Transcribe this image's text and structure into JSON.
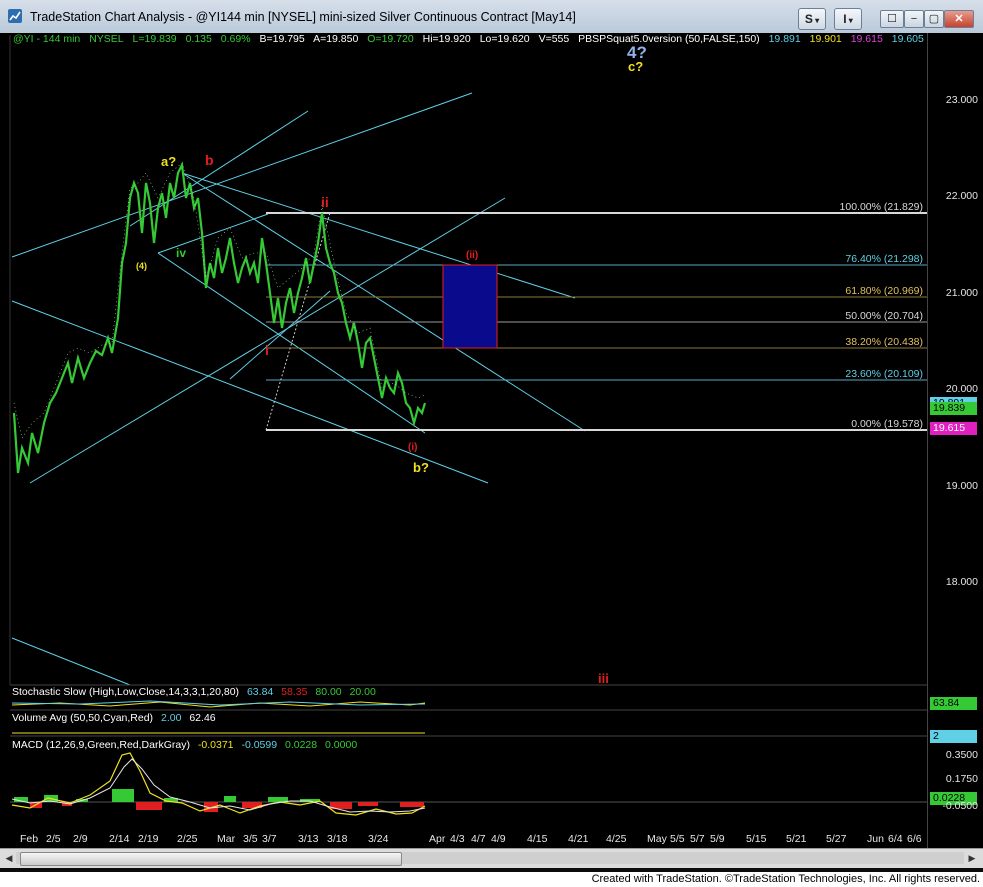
{
  "window": {
    "title": "TradeStation Chart Analysis - @YI144 min [NYSEL] mini-sized Silver Continuous Contract [May14]",
    "toolbar_s": "S",
    "toolbar_i": "I"
  },
  "status_line": {
    "symbol": "@YI - 144 min",
    "exchange": "NYSEL",
    "last": "L=19.839",
    "change": "0.135",
    "change_pct": "0.69%",
    "bid": "B=19.795",
    "ask": "A=19.850",
    "open": "O=19.720",
    "high": "Hi=19.920",
    "low": "Lo=19.620",
    "volume": "V=555",
    "study": "PBSPSquat5.0version (50,FALSE,150)",
    "study_values": [
      "19.891",
      "19.901",
      "19.615",
      "19.605"
    ]
  },
  "price_axis": {
    "labels": [
      "23.000",
      "22.000",
      "21.000",
      "20.000",
      "19.000",
      "18.000"
    ],
    "last_price_tag": "19.839",
    "partial_tag": "19.891",
    "low_tag": "19.615"
  },
  "fib_levels": [
    {
      "label": "100.00% (21.829)",
      "price": 21.829
    },
    {
      "label": "76.40% (21.298)",
      "price": 21.298
    },
    {
      "label": "61.80% (20.969)",
      "price": 20.969
    },
    {
      "label": "50.00% (20.704)",
      "price": 20.704
    },
    {
      "label": "38.20% (20.438)",
      "price": 20.438
    },
    {
      "label": "23.60% (20.109)",
      "price": 20.109
    },
    {
      "label": "0.00% (19.578)",
      "price": 19.578
    }
  ],
  "wave_labels": {
    "a_q": "a?",
    "b_red": "b",
    "ii_red": "ii",
    "i_red": "i",
    "iv": "iv",
    "four": "(4)",
    "i_circle": "(i)",
    "ii_circle": "(ii)",
    "b_q": "b?",
    "c_q": "c?",
    "four_q": "4?",
    "iii_red": "iii"
  },
  "indicators": {
    "stochastic": {
      "name": "Stochastic Slow (High,Low,Close,14,3,3,1,20,80)",
      "v1": "63.84",
      "v2": "58.35",
      "v3": "80.00",
      "v4": "20.00",
      "tag": "63.84"
    },
    "volume": {
      "name": "Volume Avg (50,50,Cyan,Red)",
      "v1": "2.00",
      "v2": "62.46",
      "tag": "2"
    },
    "macd": {
      "name": "MACD (12,26,9,Green,Red,DarkGray)",
      "v1": "-0.0371",
      "v2": "-0.0599",
      "v3": "0.0228",
      "v4": "0.0000",
      "axis_top": "0.3500",
      "axis_mid": "0.1750",
      "axis_bot": "-0.0500",
      "tag": "0.0228"
    }
  },
  "time_axis": [
    "Feb",
    "2/5",
    "2/9",
    "2/14",
    "2/19",
    "2/25",
    "Mar",
    "3/5",
    "3/7",
    "3/13",
    "3/18",
    "3/24",
    "Apr",
    "4/3",
    "4/7",
    "4/9",
    "4/15",
    "4/21",
    "4/25",
    "May",
    "5/5",
    "5/7",
    "5/9",
    "5/15",
    "5/21",
    "5/27",
    "Jun",
    "6/4",
    "6/6"
  ],
  "footer": "Created with TradeStation. ©TradeStation Technologies, Inc. All rights reserved.",
  "colors": {
    "cyan": "#5fd0e6",
    "yellow": "#f0e020",
    "red": "#e02020",
    "green": "#36c936",
    "blue_box": "#0a0a8c",
    "white_line": "#d8d8d8"
  }
}
